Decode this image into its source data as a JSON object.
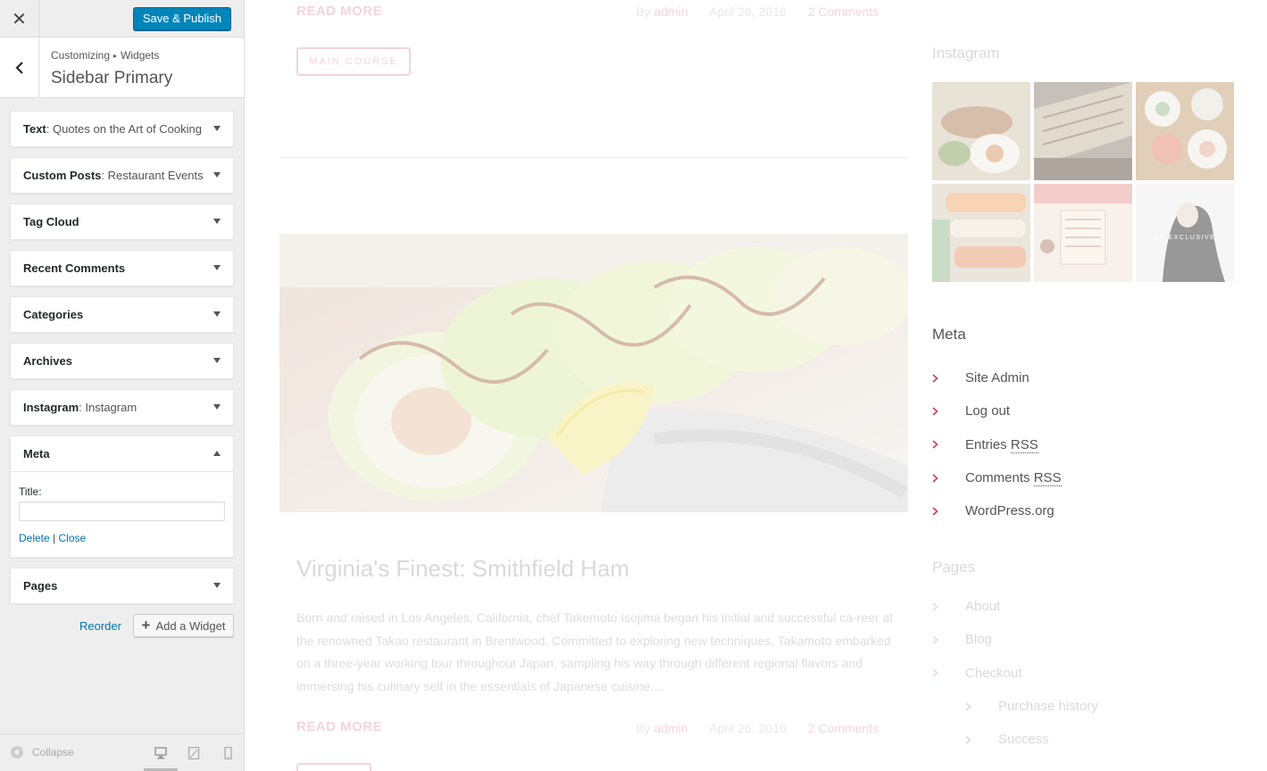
{
  "customizer": {
    "close_label": "✕",
    "publish_label": "Save & Publish",
    "breadcrumb": {
      "root": "Customizing",
      "separator": "▸",
      "current": "Widgets"
    },
    "section_title": "Sidebar Primary",
    "widgets": [
      {
        "type": "Text",
        "title": ": Quotes on the Art of Cooking"
      },
      {
        "type": "Custom Posts",
        "title": ": Restaurant Events"
      },
      {
        "type": "Tag Cloud",
        "title": ""
      },
      {
        "type": "Recent Comments",
        "title": ""
      },
      {
        "type": "Categories",
        "title": ""
      },
      {
        "type": "Archives",
        "title": ""
      },
      {
        "type": "Instagram",
        "title": ": Instagram"
      },
      {
        "type": "Meta",
        "title": ""
      },
      {
        "type": "Pages",
        "title": ""
      }
    ],
    "meta_form": {
      "title_label": "Title:",
      "title_value": "",
      "delete_label": "Delete",
      "action_separator": "|",
      "close_label": "Close"
    },
    "reorder_label": "Reorder",
    "add_widget_label": "Add a Widget",
    "collapse_label": "Collapse"
  },
  "preview": {
    "post1": {
      "read_more": "READ MORE",
      "by": "By",
      "author": "admin",
      "date": "April 26, 2016",
      "comments": "2 Comments",
      "tag": "MAIN COURSE"
    },
    "post2": {
      "title": "Virginia's Finest: Smithfield Ham",
      "excerpt": "Born and raised in Los Angeles, California, chef Takemoto Isojima began his initial and successful ca-reer at the renowned Takao restaurant in Brentwood. Committed to exploring new techniques, Takamoto embarked on a three-year working tour throughout Japan, sampling his way through different regional flavors and immersing his culinary self in the essentials of Japanese cuisine,...",
      "read_more": "READ MORE",
      "by": "By",
      "author": "admin",
      "date": "April 26, 2016",
      "comments": "2 Comments"
    },
    "instagram_title": "Instagram",
    "meta_title": "Meta",
    "meta_links": [
      {
        "text": "Site Admin"
      },
      {
        "text": "Log out"
      },
      {
        "pre": "Entries ",
        "abbr": "RSS"
      },
      {
        "pre": "Comments ",
        "abbr": "RSS"
      },
      {
        "text": "WordPress.org"
      }
    ],
    "pages_title": "Pages",
    "pages": [
      "About",
      "Blog",
      "Checkout",
      "Purchase history",
      "Success"
    ],
    "accent_color": "#d23b5b",
    "wp_blue": "#0085ba"
  }
}
